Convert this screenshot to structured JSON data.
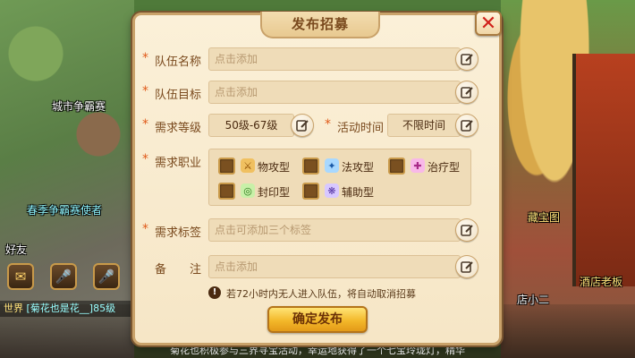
{
  "background": {
    "labels": {
      "city_tournament": "城市争霸赛",
      "npc_name": "春季争霸赛使者",
      "friends": "好友",
      "treasure_map": "藏宝图",
      "tavern": "酒店老板",
      "shop_owner": "店小二"
    },
    "chat": {
      "world_prefix": "世界",
      "world_message": "[菊花也是花__]85级",
      "system_message": "菊花也积极参与三界寻宝活动，幸运地获得了一个七宝玲珑灯，精华"
    },
    "icons": [
      "chat-icon",
      "voice-world-icon",
      "voice-team-icon"
    ]
  },
  "dialog": {
    "title": "发布招募",
    "required_mark": "*",
    "fields": {
      "team_name": {
        "label": "队伍名称",
        "placeholder": "点击添加"
      },
      "team_goal": {
        "label": "队伍目标",
        "placeholder": "点击添加"
      },
      "level_req": {
        "label": "需求等级",
        "value": "50级-67级"
      },
      "activity_time": {
        "label": "活动时间",
        "value": "不限时间"
      },
      "job_req": {
        "label": "需求职业"
      },
      "tags": {
        "label": "需求标签",
        "placeholder": "点击可添加三个标签"
      },
      "remark": {
        "label": "备　　注",
        "placeholder": "点击添加"
      }
    },
    "jobs": [
      {
        "label": "物攻型",
        "checked": false,
        "icon": "physical-attack-icon",
        "color": "#e8a020"
      },
      {
        "label": "法攻型",
        "checked": false,
        "icon": "magic-attack-icon",
        "color": "#3a8ad8"
      },
      {
        "label": "治疗型",
        "checked": false,
        "icon": "heal-icon",
        "color": "#d85ab8"
      },
      {
        "label": "封印型",
        "checked": false,
        "icon": "seal-icon",
        "color": "#5ab83a"
      },
      {
        "label": "辅助型",
        "checked": false,
        "icon": "support-icon",
        "color": "#8a6ad8"
      }
    ],
    "notice": "若72小时内无人进入队伍，将自动取消招募",
    "confirm_label": "确定发布",
    "close_label": "✕"
  }
}
